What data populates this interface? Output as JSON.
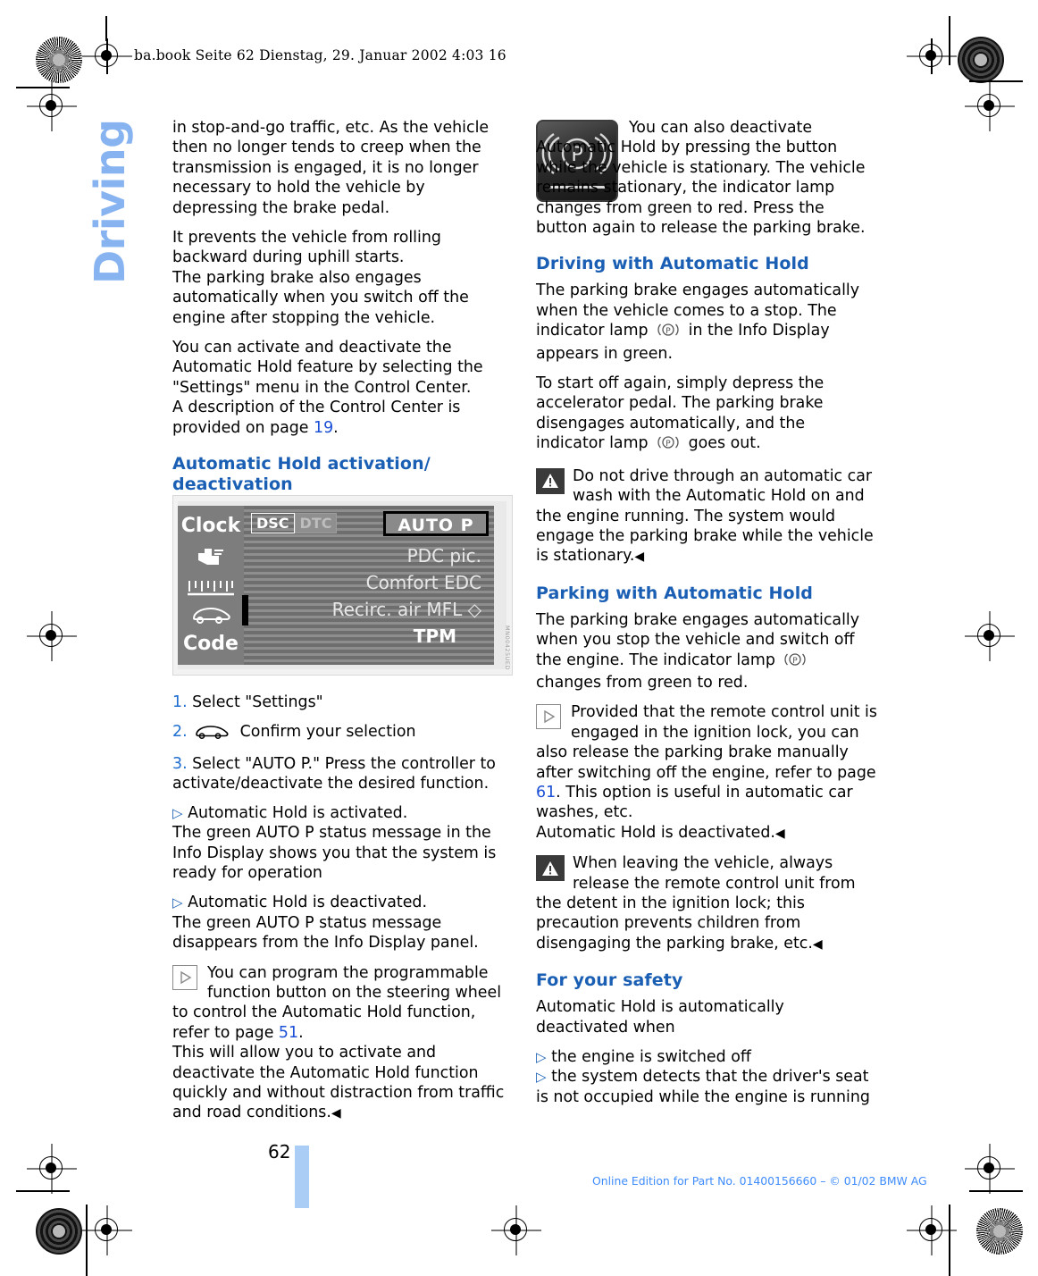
{
  "header": {
    "file_line": "ba.book  Seite 62  Dienstag, 29. Januar 2002  4:03 16"
  },
  "chapter_tab": {
    "label": "Driving"
  },
  "left_column": {
    "para_1": "in stop-and-go traffic, etc. As the vehicle then no longer tends to creep when the transmission is engaged, it is no longer necessary to hold the vehicle by depressing the brake pedal.",
    "para_2": "It prevents the vehicle from rolling backward during uphill starts.",
    "para_3": "The parking brake also engages automatically when you switch off the engine after stopping the vehicle.",
    "para_4a": "You can activate and deactivate the Automatic Hold feature by selecting the \"Settings\" menu in the Control Center.",
    "para_4b_pre": "A description of the Control Center is provided on page ",
    "para_4b_page": "19",
    "para_4b_post": ".",
    "heading_1": "Automatic Hold activation/ deactivation",
    "steps": [
      {
        "num": "1.",
        "text": "Select \"Settings\"",
        "icon": ""
      },
      {
        "num": "2.",
        "text": "Confirm your selection",
        "icon": "car-controller-icon"
      },
      {
        "num": "3.",
        "text": "Select \"AUTO P.\" Press the controller to activate/deactivate the desired function.",
        "icon": ""
      }
    ],
    "bullet_1_lead": "Automatic Hold is activated.",
    "bullet_1_body": "The green AUTO P status message in the Info Display shows you that the system is ready for operation",
    "bullet_2_lead": "Automatic Hold is deactivated.",
    "bullet_2_body": "The green AUTO P status message disappears from the Info Display panel.",
    "note_1_a": "You can program the programmable function button on the steering wheel to control the Automatic Hold function, refer to page ",
    "note_1_page": "51",
    "note_1_b": ".",
    "note_1_c": "This will allow you to activate and deactivate the Automatic Hold function quickly and without distraction from traffic and road conditions.",
    "note_1_end": "◀"
  },
  "control_center_figure": {
    "sidebar_items": [
      "Clock",
      "hand-pointer-icon",
      "scale-icon",
      "car-icon",
      "Code"
    ],
    "sidebar_labels": {
      "clock": "Clock",
      "code": "Code"
    },
    "status_chips": [
      {
        "label": "DSC",
        "state": "on"
      },
      {
        "label": "DTC",
        "state": "off"
      }
    ],
    "selected_item": "AUTO  P",
    "menu_items": [
      "PDC pic.",
      "Comfort  EDC",
      "Recirc. air  MFL ◇",
      "TPM"
    ],
    "image_code": "MN00425UED"
  },
  "right_column": {
    "note_top": "You can also deactivate Automatic Hold by pressing the button while the vehicle is stationary. The vehicle remains stationary, the indicator lamp changes from green to red. Press the button again to release the parking brake.",
    "heading_driving": "Driving with Automatic Hold",
    "driving_a": "The parking brake engages automatically when the vehicle comes to a stop. The indicator lamp",
    "driving_b": "in the Info Display appears in green.",
    "driving_c": "To start off again, simply depress the accelerator pedal. The parking brake disengages automatically, and the indicator lamp",
    "driving_d": "goes out.",
    "warn_1": "Do not drive through an automatic car wash with the Automatic Hold on and the engine running. The system would engage the parking brake while the vehicle is stationary.",
    "warn_1_end": "◀",
    "heading_parking": "Parking with Automatic Hold",
    "parking_a": "The parking brake engages automatically when you stop the vehicle and switch off the engine. The indicator lamp",
    "parking_b": "changes from green to red.",
    "note_2_a": "Provided that the remote control unit is engaged in the ignition lock, you can also release the parking brake manually after switching off the engine, refer to page ",
    "note_2_page": "61",
    "note_2_b": ". This option is useful in automatic car washes, etc.",
    "note_2_c": "Automatic Hold is deactivated.",
    "note_2_end": "◀",
    "warn_2": "When leaving the vehicle, always release the remote control unit from the detent in the ignition lock; this precaution prevents children from disengaging the parking brake, etc.",
    "warn_2_end": "◀",
    "heading_safety": "For your safety",
    "safety_intro": "Automatic Hold is automatically deactivated when",
    "safety_bullets": [
      "the engine is switched off",
      "the system detects that the driver's seat is not occupied while the engine is running"
    ]
  },
  "footer": {
    "page_number": "62",
    "copyright": "Online Edition for Part No. 01400156660 – © 01/02 BMW AG"
  },
  "colors": {
    "heading_blue": "#1a5fb4",
    "link_blue": "#1a4fd6",
    "tab_blue": "#87b4f0",
    "footer_blue": "#3d8bfd"
  }
}
